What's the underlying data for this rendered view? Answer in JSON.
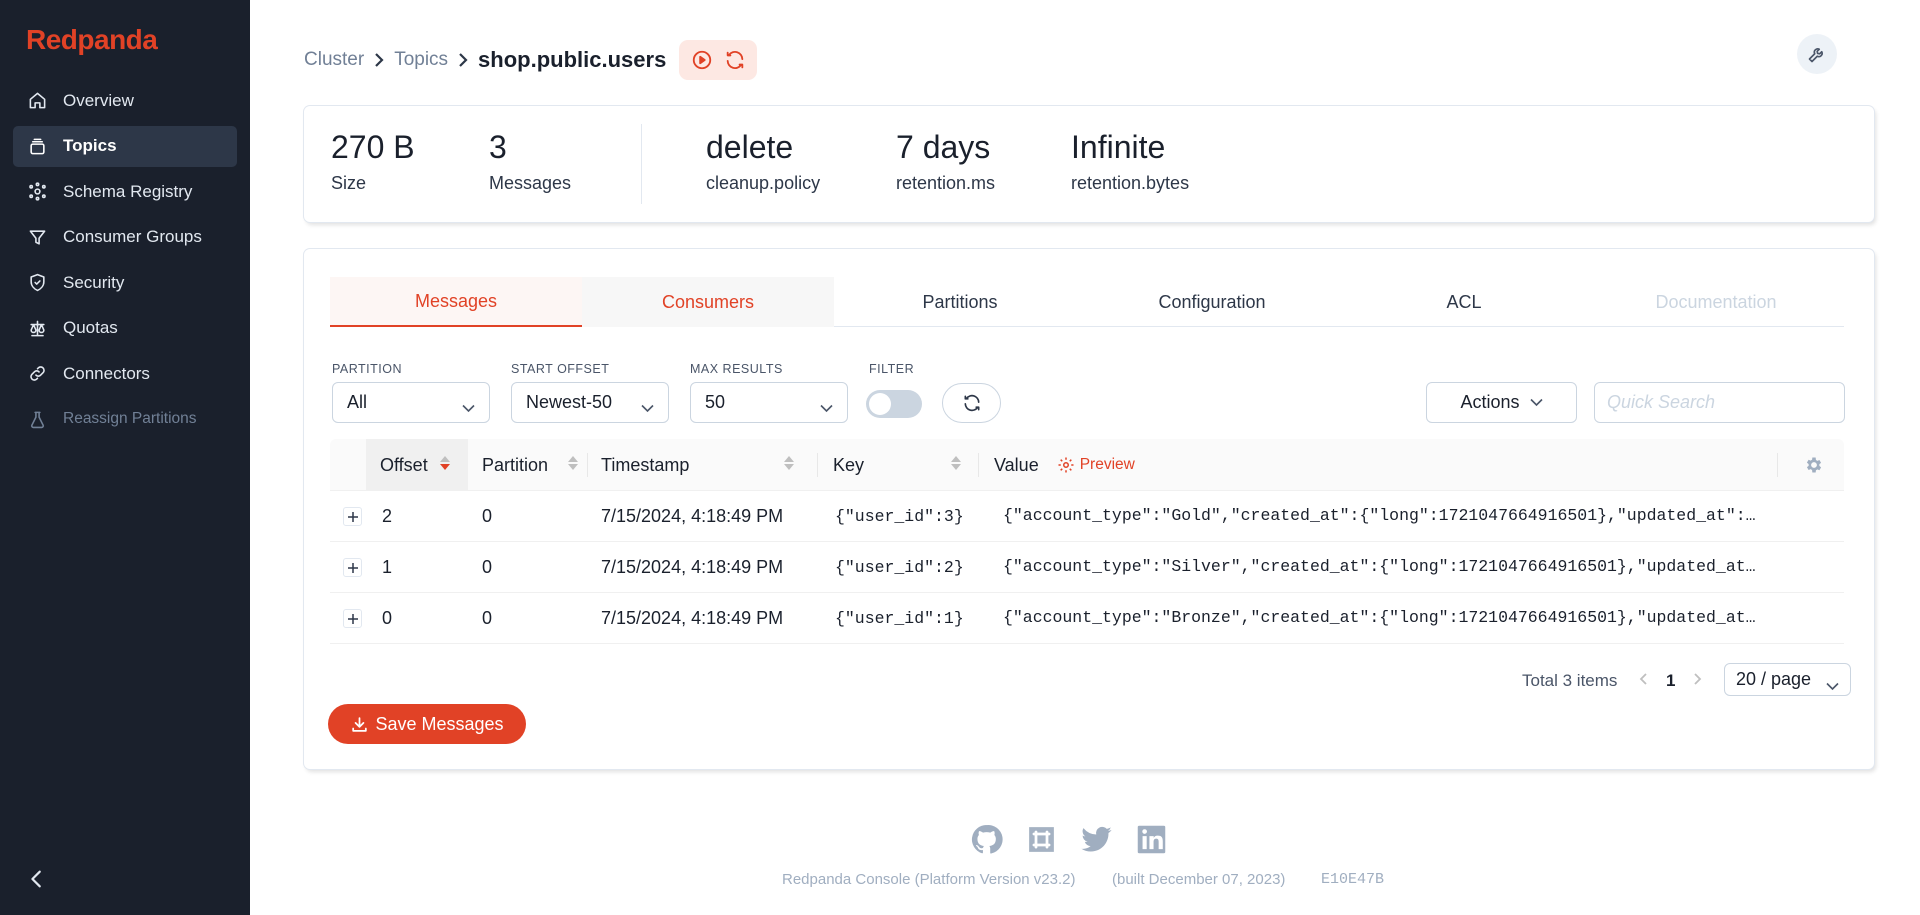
{
  "app": {
    "logo": "Redpanda"
  },
  "sidebar": {
    "items": [
      {
        "label": "Overview",
        "icon": "home-icon"
      },
      {
        "label": "Topics",
        "icon": "topics-icon",
        "active": true
      },
      {
        "label": "Schema Registry",
        "icon": "schema-icon"
      },
      {
        "label": "Consumer Groups",
        "icon": "funnel-icon"
      },
      {
        "label": "Security",
        "icon": "shield-icon"
      },
      {
        "label": "Quotas",
        "icon": "scale-icon"
      },
      {
        "label": "Connectors",
        "icon": "link-icon"
      },
      {
        "label": "Reassign Partitions",
        "icon": "beaker-icon",
        "disabled": true
      }
    ]
  },
  "header": {
    "breadcrumbs": [
      "Cluster",
      "Topics"
    ],
    "current": "shop.public.users"
  },
  "stats": {
    "size": {
      "value": "270 B",
      "label": "Size"
    },
    "messages": {
      "value": "3",
      "label": "Messages"
    },
    "cleanup": {
      "value": "delete",
      "label": "cleanup.policy"
    },
    "retention_ms": {
      "value": "7 days",
      "label": "retention.ms"
    },
    "retention_bytes": {
      "value": "Infinite",
      "label": "retention.bytes"
    }
  },
  "tabs": [
    {
      "label": "Messages",
      "state": "active"
    },
    {
      "label": "Consumers",
      "state": "hover"
    },
    {
      "label": "Partitions",
      "state": "normal"
    },
    {
      "label": "Configuration",
      "state": "normal"
    },
    {
      "label": "ACL",
      "state": "normal"
    },
    {
      "label": "Documentation",
      "state": "disabled"
    }
  ],
  "filters": {
    "partition": {
      "label": "PARTITION",
      "value": "All"
    },
    "start_offset": {
      "label": "START OFFSET",
      "value": "Newest-50"
    },
    "max_results": {
      "label": "MAX RESULTS",
      "value": "50"
    },
    "filter": {
      "label": "FILTER",
      "enabled": false
    },
    "actions_label": "Actions",
    "search_placeholder": "Quick Search"
  },
  "table": {
    "columns": [
      "Offset",
      "Partition",
      "Timestamp",
      "Key",
      "Value"
    ],
    "preview_label": "Preview",
    "rows": [
      {
        "offset": "2",
        "partition": "0",
        "timestamp": "7/15/2024, 4:18:49 PM",
        "key": "{\"user_id\":3}",
        "value": "{\"account_type\":\"Gold\",\"created_at\":{\"long\":1721047664916501},\"updated_at\":…"
      },
      {
        "offset": "1",
        "partition": "0",
        "timestamp": "7/15/2024, 4:18:49 PM",
        "key": "{\"user_id\":2}",
        "value": "{\"account_type\":\"Silver\",\"created_at\":{\"long\":1721047664916501},\"updated_at…"
      },
      {
        "offset": "0",
        "partition": "0",
        "timestamp": "7/15/2024, 4:18:49 PM",
        "key": "{\"user_id\":1}",
        "value": "{\"account_type\":\"Bronze\",\"created_at\":{\"long\":1721047664916501},\"updated_at…"
      }
    ]
  },
  "pagination": {
    "total": "Total 3 items",
    "page": "1",
    "page_size": "20 / page"
  },
  "save_label": "Save Messages",
  "footer": {
    "version": "Redpanda Console (Platform Version v23.2)",
    "built": "(built December 07, 2023)",
    "hash": "E10E47B",
    "icons": [
      "github-icon",
      "slack-icon",
      "twitter-icon",
      "linkedin-icon"
    ]
  },
  "colors": {
    "accent": "#e14226",
    "sidebar": "#1a202c"
  }
}
